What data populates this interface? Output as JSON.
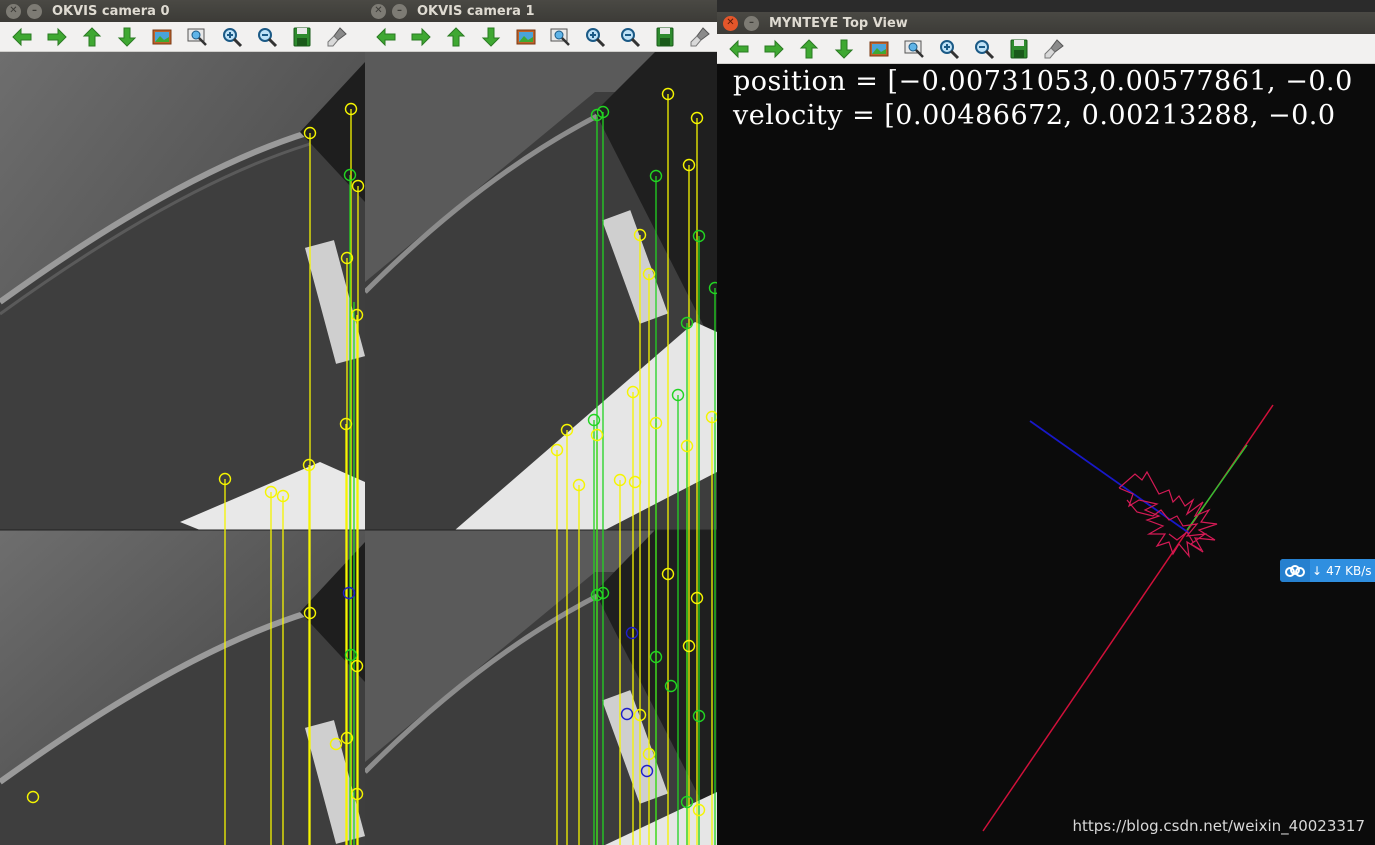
{
  "windows": {
    "cam0": {
      "title": "OKVIS camera 0"
    },
    "cam1": {
      "title": "OKVIS camera 1"
    },
    "top": {
      "title": "MYNTEYE Top View"
    }
  },
  "toolbar_icons": [
    "arrow-left-icon",
    "arrow-right-icon",
    "arrow-up-icon",
    "arrow-down-icon",
    "image-icon",
    "zoom-fit-icon",
    "zoom-in-icon",
    "zoom-out-icon",
    "save-icon",
    "brush-icon"
  ],
  "top_view": {
    "position_text": "position = [−0.00731053,0.00577861, −0.0",
    "velocity_text": "velocity = [0.00486672, 0.00213288, −0.0"
  },
  "network_widget": {
    "speed": "47 KB/s",
    "icon": "cloud-icon",
    "arrow": "↓"
  },
  "watermark": "https://blog.csdn.net/weixin_40023317",
  "colors": {
    "feature_yellow": "#f5f500",
    "feature_green": "#22d422",
    "feature_blue": "#2020c8",
    "axis_red": "#d0103a",
    "axis_blue": "#1818c8",
    "axis_green": "#30c030",
    "trajectory": "#d41a55"
  }
}
